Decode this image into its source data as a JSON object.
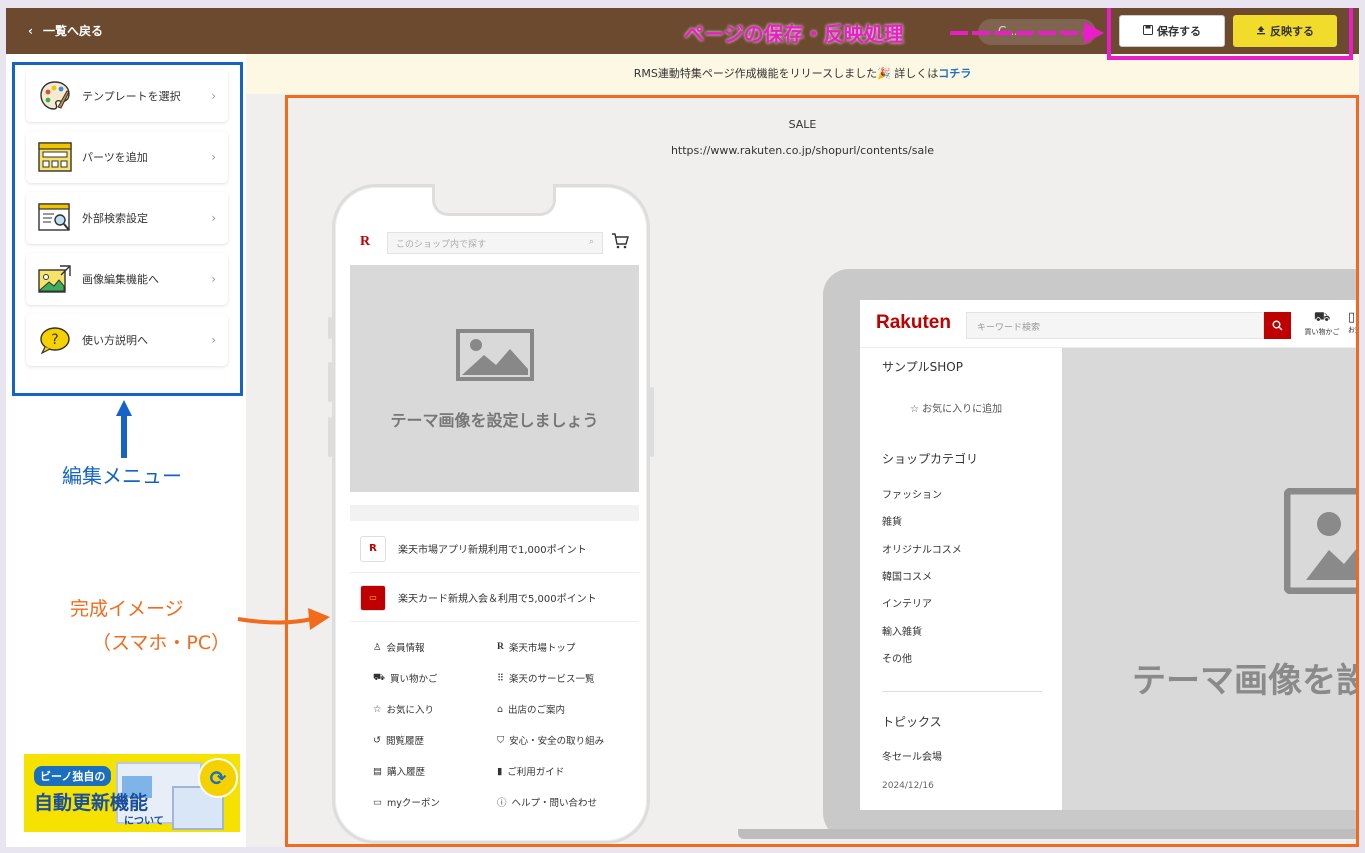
{
  "topbar": {
    "back_label": "一覧へ戻る",
    "save_label": "保存する",
    "publish_label": "反映する",
    "dimmed_label": "C..."
  },
  "notice": {
    "text": "RMS連動特集ページ作成機能をリリースしました🎉 詳しくは",
    "link": "コチラ"
  },
  "sidebar": {
    "items": [
      {
        "label": "テンプレートを選択",
        "icon": "palette-icon"
      },
      {
        "label": "パーツを追加",
        "icon": "layout-grid-icon"
      },
      {
        "label": "外部検索設定",
        "icon": "search-window-icon"
      },
      {
        "label": "画像編集機能へ",
        "icon": "image-edit-icon"
      },
      {
        "label": "使い方説明へ",
        "icon": "question-bubble-icon"
      }
    ]
  },
  "banner": {
    "line1": "ビーノ独自の",
    "line2": "自動更新機能",
    "line3": "について"
  },
  "stage": {
    "title": "SALE",
    "url": "https://www.rakuten.co.jp/shopurl/contents/sale"
  },
  "phone": {
    "search_placeholder": "このショップ内で探す",
    "hero_text": "テーマ画像を設定しましょう",
    "promos": [
      {
        "text": "楽天市場アプリ新規利用で1,000ポイント"
      },
      {
        "text": "楽天カード新規入会＆利用で5,000ポイント"
      }
    ],
    "links": [
      {
        "label": "会員情報",
        "icon": "user-icon"
      },
      {
        "label": "楽天市場トップ",
        "icon": "rakuten-r-icon"
      },
      {
        "label": "買い物かご",
        "icon": "cart-icon"
      },
      {
        "label": "楽天のサービス一覧",
        "icon": "grid-dots-icon"
      },
      {
        "label": "お気に入り",
        "icon": "star-icon"
      },
      {
        "label": "出店のご案内",
        "icon": "store-icon"
      },
      {
        "label": "閲覧履歴",
        "icon": "history-icon"
      },
      {
        "label": "安心・安全の取り組み",
        "icon": "shield-icon"
      },
      {
        "label": "購入履歴",
        "icon": "receipt-icon"
      },
      {
        "label": "ご利用ガイド",
        "icon": "book-icon"
      },
      {
        "label": "myクーポン",
        "icon": "coupon-icon"
      },
      {
        "label": "ヘルプ・問い合わせ",
        "icon": "help-icon"
      }
    ]
  },
  "pc": {
    "logo": "Rakuten",
    "search_placeholder": "キーワード検索",
    "cart_label": "買い物かご",
    "notice_label": "お知",
    "shop_name": "サンプルSHOP",
    "favorite": "お気に入りに追加",
    "category_heading": "ショップカテゴリ",
    "categories": [
      "ファッション",
      "雑貨",
      "オリジナルコスメ",
      "韓国コスメ",
      "インテリア",
      "輸入雑貨",
      "その他"
    ],
    "topics_heading": "トピックス",
    "topic_title": "冬セール会場",
    "topic_date": "2024/12/16",
    "hero_text": "テーマ画像を設"
  },
  "annotations": {
    "save_publish": "ページの保存・反映処理",
    "edit_menu": "編集メニュー",
    "preview_line1": "完成イメージ",
    "preview_line2": "（スマホ・PC）"
  },
  "colors": {
    "topbar": "#6b4a2f",
    "publish": "#f1db2b",
    "annotation_magenta": "#e91ec8",
    "annotation_blue": "#1563c7",
    "annotation_orange": "#f26b1d",
    "rakuten_red": "#bf0000"
  }
}
